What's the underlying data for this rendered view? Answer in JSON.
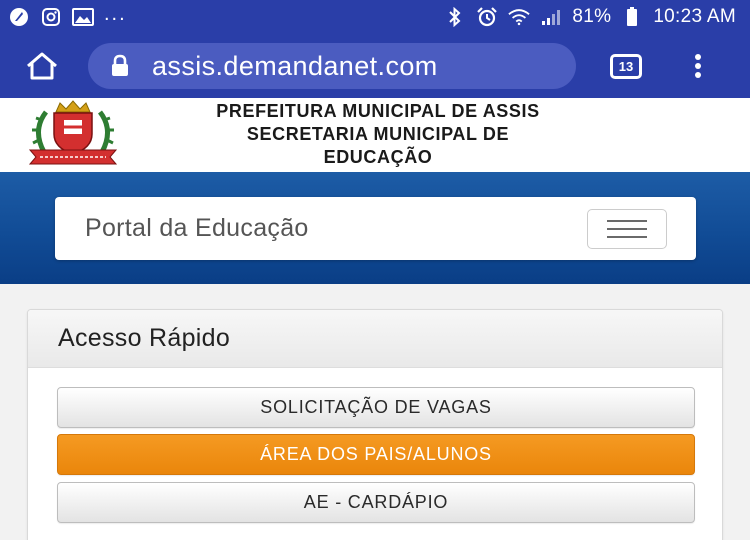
{
  "status_bar": {
    "icons_left": [
      "app-icon",
      "instagram-icon",
      "gallery-icon"
    ],
    "more": "...",
    "icons_right": [
      "bluetooth-icon",
      "alarm-icon",
      "wifi-icon",
      "signal-icon",
      "battery-icon"
    ],
    "battery": "81%",
    "time": "10:23 AM"
  },
  "browser": {
    "url": "assis.demandanet.com",
    "tab_count": "13"
  },
  "header": {
    "line1": "PREFEITURA MUNICIPAL DE ASSIS",
    "line2": "SECRETARIA MUNICIPAL DE",
    "line3": "EDUCAÇÃO"
  },
  "navbar": {
    "brand": "Portal da Educação"
  },
  "quick_access": {
    "title": "Acesso Rápido",
    "buttons": [
      {
        "label": "SOLICITAÇÃO DE VAGAS"
      },
      {
        "label": "ÁREA DOS PAIS/ALUNOS"
      },
      {
        "label": "AE - CARDÁPIO"
      }
    ]
  },
  "colors": {
    "browser_blue": "#2a3ea8",
    "banner_blue": "#114c96",
    "accent_orange": "#ea860b"
  }
}
